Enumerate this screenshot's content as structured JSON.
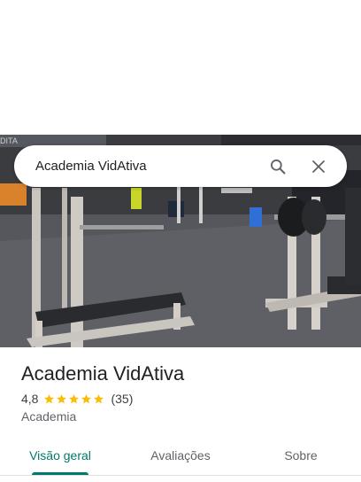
{
  "search": {
    "query": "Academia VidAtiva",
    "search_icon": "search-icon",
    "close_icon": "close-icon"
  },
  "hero": {
    "photo_icon": "gym-interior-photo",
    "sign_text": "DITA"
  },
  "place": {
    "name": "Academia VidAtiva",
    "rating": "4,8",
    "stars": 5,
    "reviews": "(35)",
    "category": "Academia"
  },
  "tabs": [
    {
      "label": "Visão geral",
      "active": true
    },
    {
      "label": "Avaliações",
      "active": false
    },
    {
      "label": "Sobre",
      "active": false
    }
  ],
  "colors": {
    "accent": "#00796b",
    "star": "#fbbc04"
  }
}
